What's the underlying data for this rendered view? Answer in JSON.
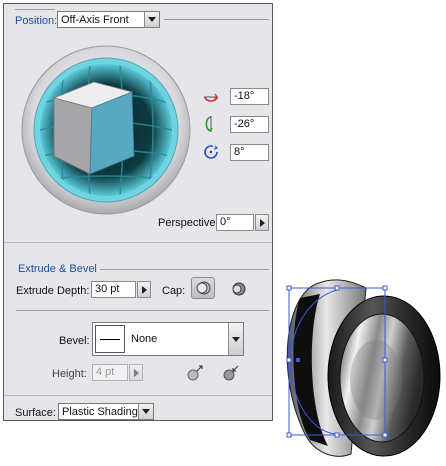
{
  "position": {
    "label": "Position:",
    "preset": "Off-Axis Front",
    "x_rotation": "-18°",
    "y_rotation": "-26°",
    "z_rotation": "8°",
    "perspective_label": "Perspective:",
    "perspective_value": "0°"
  },
  "extrude_bevel": {
    "section_title": "Extrude & Bevel",
    "depth_label": "Extrude Depth:",
    "depth_value": "30 pt",
    "cap_label": "Cap:",
    "bevel_label": "Bevel:",
    "bevel_value": "None",
    "height_label": "Height:",
    "height_value": "4 pt"
  },
  "surface": {
    "label": "Surface:",
    "value": "Plastic Shading"
  }
}
